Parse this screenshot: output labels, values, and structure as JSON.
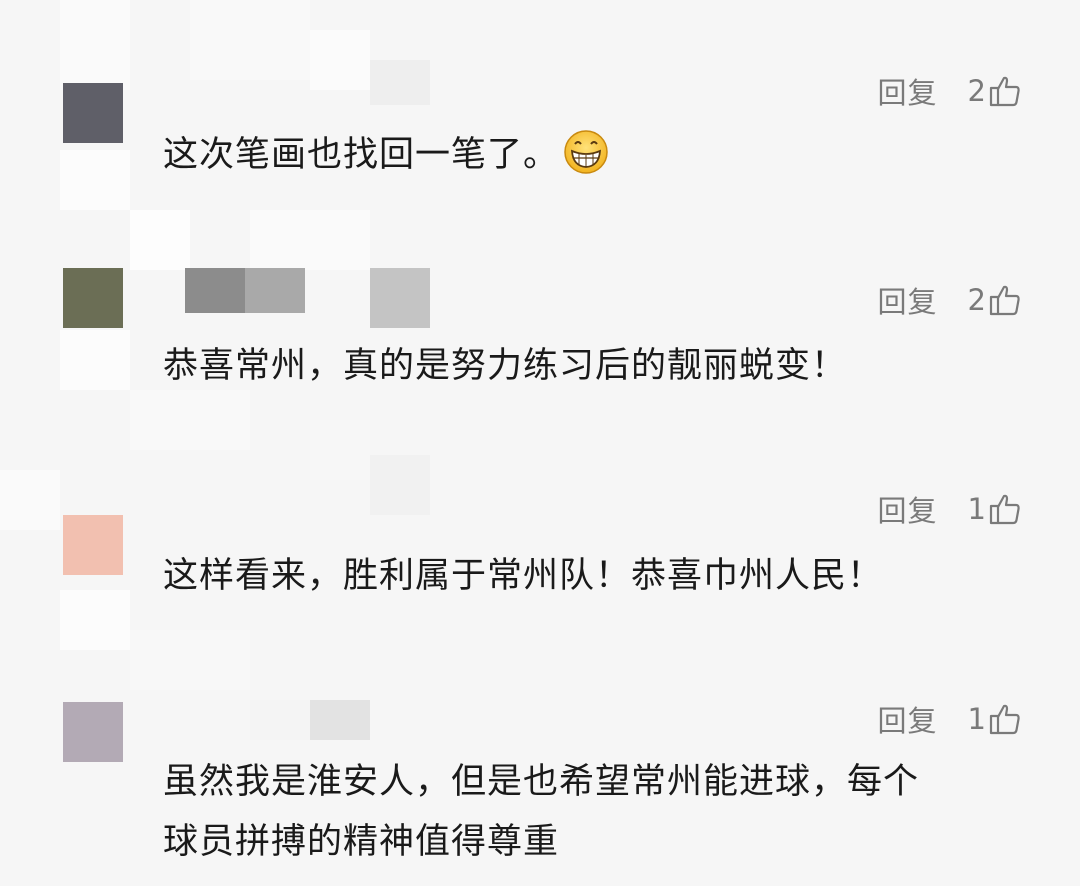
{
  "comments": [
    {
      "reply_label": "回复",
      "like_count": "2",
      "text": "这次笔画也找回一笔了。",
      "emoji": "grinning-face-emoji",
      "avatar_color": "#5f5f68"
    },
    {
      "reply_label": "回复",
      "like_count": "2",
      "text": "恭喜常州，真的是努力练习后的靓丽蜕变！",
      "avatar_color": "#6b6e55"
    },
    {
      "reply_label": "回复",
      "like_count": "1",
      "text": "这样看来，胜利属于常州队！恭喜巾州人民！",
      "avatar_color": "#f2c0b0"
    },
    {
      "reply_label": "回复",
      "like_count": "1",
      "text_line1": "虽然我是淮安人，但是也希望常州能进球，每个",
      "text_line2": "球员拼搏的精神值得尊重",
      "avatar_color": "#b3aab5"
    }
  ],
  "icons": {
    "like": "thumbs-up-icon"
  },
  "colors": {
    "background": "#f6f6f6",
    "text": "#1a1a1a",
    "meta": "#7a7a7a"
  }
}
